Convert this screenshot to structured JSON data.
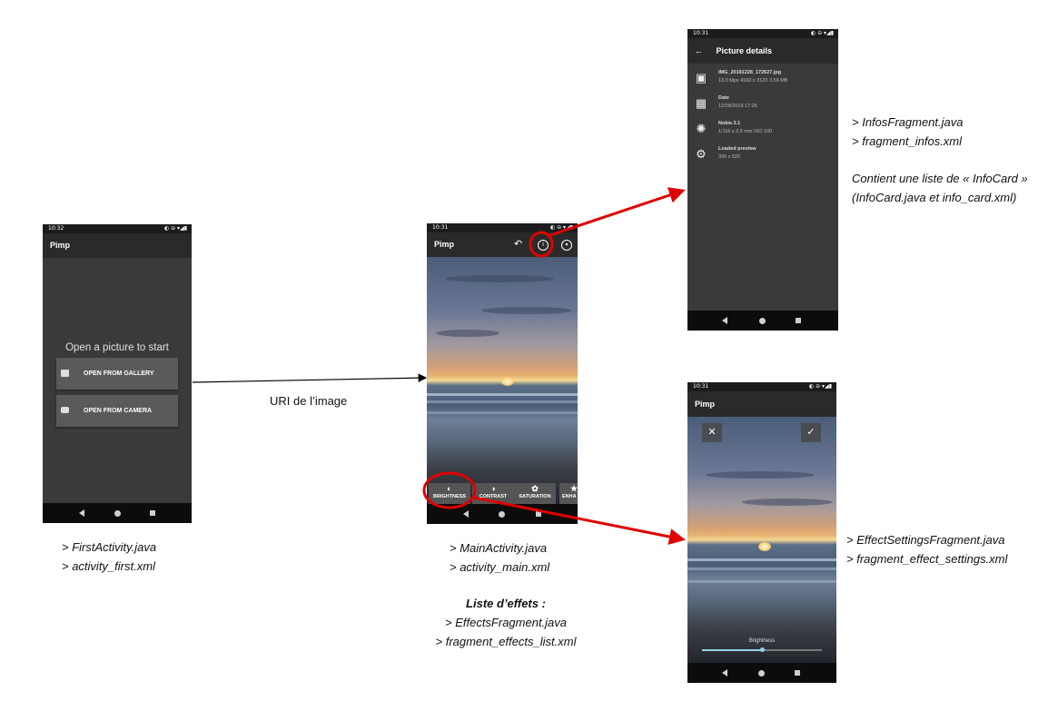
{
  "first_screen": {
    "status_time": "10:32",
    "app_title": "Pimp",
    "prompt": "Open a picture to start",
    "gallery_button": "OPEN FROM GALLERY",
    "camera_button": "OPEN FROM CAMERA",
    "notes": [
      "> FirstActivity.java",
      "> activity_first.xml"
    ]
  },
  "arrow_label": "URI de l’image",
  "main_screen": {
    "status_time": "10:31",
    "app_title": "Pimp",
    "effects": [
      "BRIGHTNESS",
      "CONTRAST",
      "SATURATION",
      "ENHA"
    ],
    "notes": [
      "> MainActivity.java",
      "> activity_main.xml"
    ],
    "effects_heading": "Liste d’effets :",
    "effects_notes": [
      "> EffectsFragment.java",
      "> fragment_effects_list.xml"
    ]
  },
  "details_screen": {
    "status_time": "10:31",
    "title": "Picture details",
    "items": [
      {
        "icon": "image-icon",
        "line1": "IMG_20191228_172627.jpg",
        "line2": "13.0 Mpx    4160 x 3120    3.59 MB"
      },
      {
        "icon": "calendar-icon",
        "line1": "Date",
        "line2": "12/28/2019 17:26"
      },
      {
        "icon": "camera-aperture-icon",
        "line1": "Nokia 3.1",
        "line2": "1/116 s    3.5 mm    ISO 100"
      },
      {
        "icon": "gear-icon",
        "line1": "Loaded preview",
        "line2": "390 x 520"
      }
    ],
    "notes": [
      "> InfosFragment.java",
      "> fragment_infos.xml"
    ],
    "card_notes": [
      "Contient une liste de « InfoCard »",
      "(InfoCard.java et info_card.xml)"
    ]
  },
  "settings_screen": {
    "status_time": "10:31",
    "app_title": "Pimp",
    "slider_label": "Brightness",
    "slider_value": 0.5,
    "notes": [
      "> EffectSettingsFragment.java",
      "> fragment_effect_settings.xml"
    ]
  },
  "colors": {
    "highlight": "#e00000",
    "arrow": "#000000",
    "slider": "#8fd3e8"
  }
}
